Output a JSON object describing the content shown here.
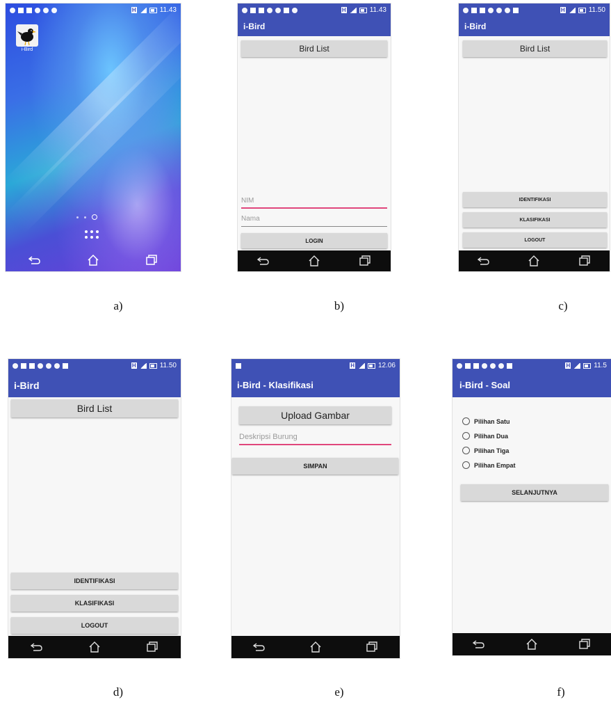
{
  "app_name": "i-Bird",
  "colors": {
    "appbar": "#3f51b5",
    "accent": "#e0467c",
    "button": "#d9d9d9",
    "navbar": "#0d0d0d"
  },
  "screens": {
    "a": {
      "caption": "a)",
      "time": "11.43",
      "app_icon_label": "i-Bird",
      "app_icon": "bird-icon"
    },
    "b": {
      "caption": "b)",
      "time": "11.43",
      "title": "i-Bird",
      "bird_list": "Bird List",
      "nim_placeholder": "NIM",
      "nama_placeholder": "Nama",
      "login": "LOGIN"
    },
    "c": {
      "caption": "c)",
      "time": "11.50",
      "title": "i-Bird",
      "bird_list": "Bird List",
      "identifikasi": "IDENTIFIKASI",
      "klasifikasi": "KLASIFIKASI",
      "logout": "LOGOUT"
    },
    "d": {
      "caption": "d)",
      "time": "11.50",
      "title": "i-Bird",
      "bird_list": "Bird List",
      "identifikasi": "IDENTIFIKASI",
      "klasifikasi": "KLASIFIKASI",
      "logout": "LOGOUT"
    },
    "e": {
      "caption": "e)",
      "time": "12.06",
      "title": "i-Bird - Klasifikasi",
      "upload": "Upload Gambar",
      "deskripsi_placeholder": "Deskripsi Burung",
      "simpan": "SIMPAN"
    },
    "f": {
      "caption": "f)",
      "time": "11.5",
      "title": "i-Bird - Soal",
      "options": [
        "Pilihan Satu",
        "Pilihan Dua",
        "Pilihan Tiga",
        "Pilihan Empat"
      ],
      "next": "SELANJUTNYA"
    }
  }
}
